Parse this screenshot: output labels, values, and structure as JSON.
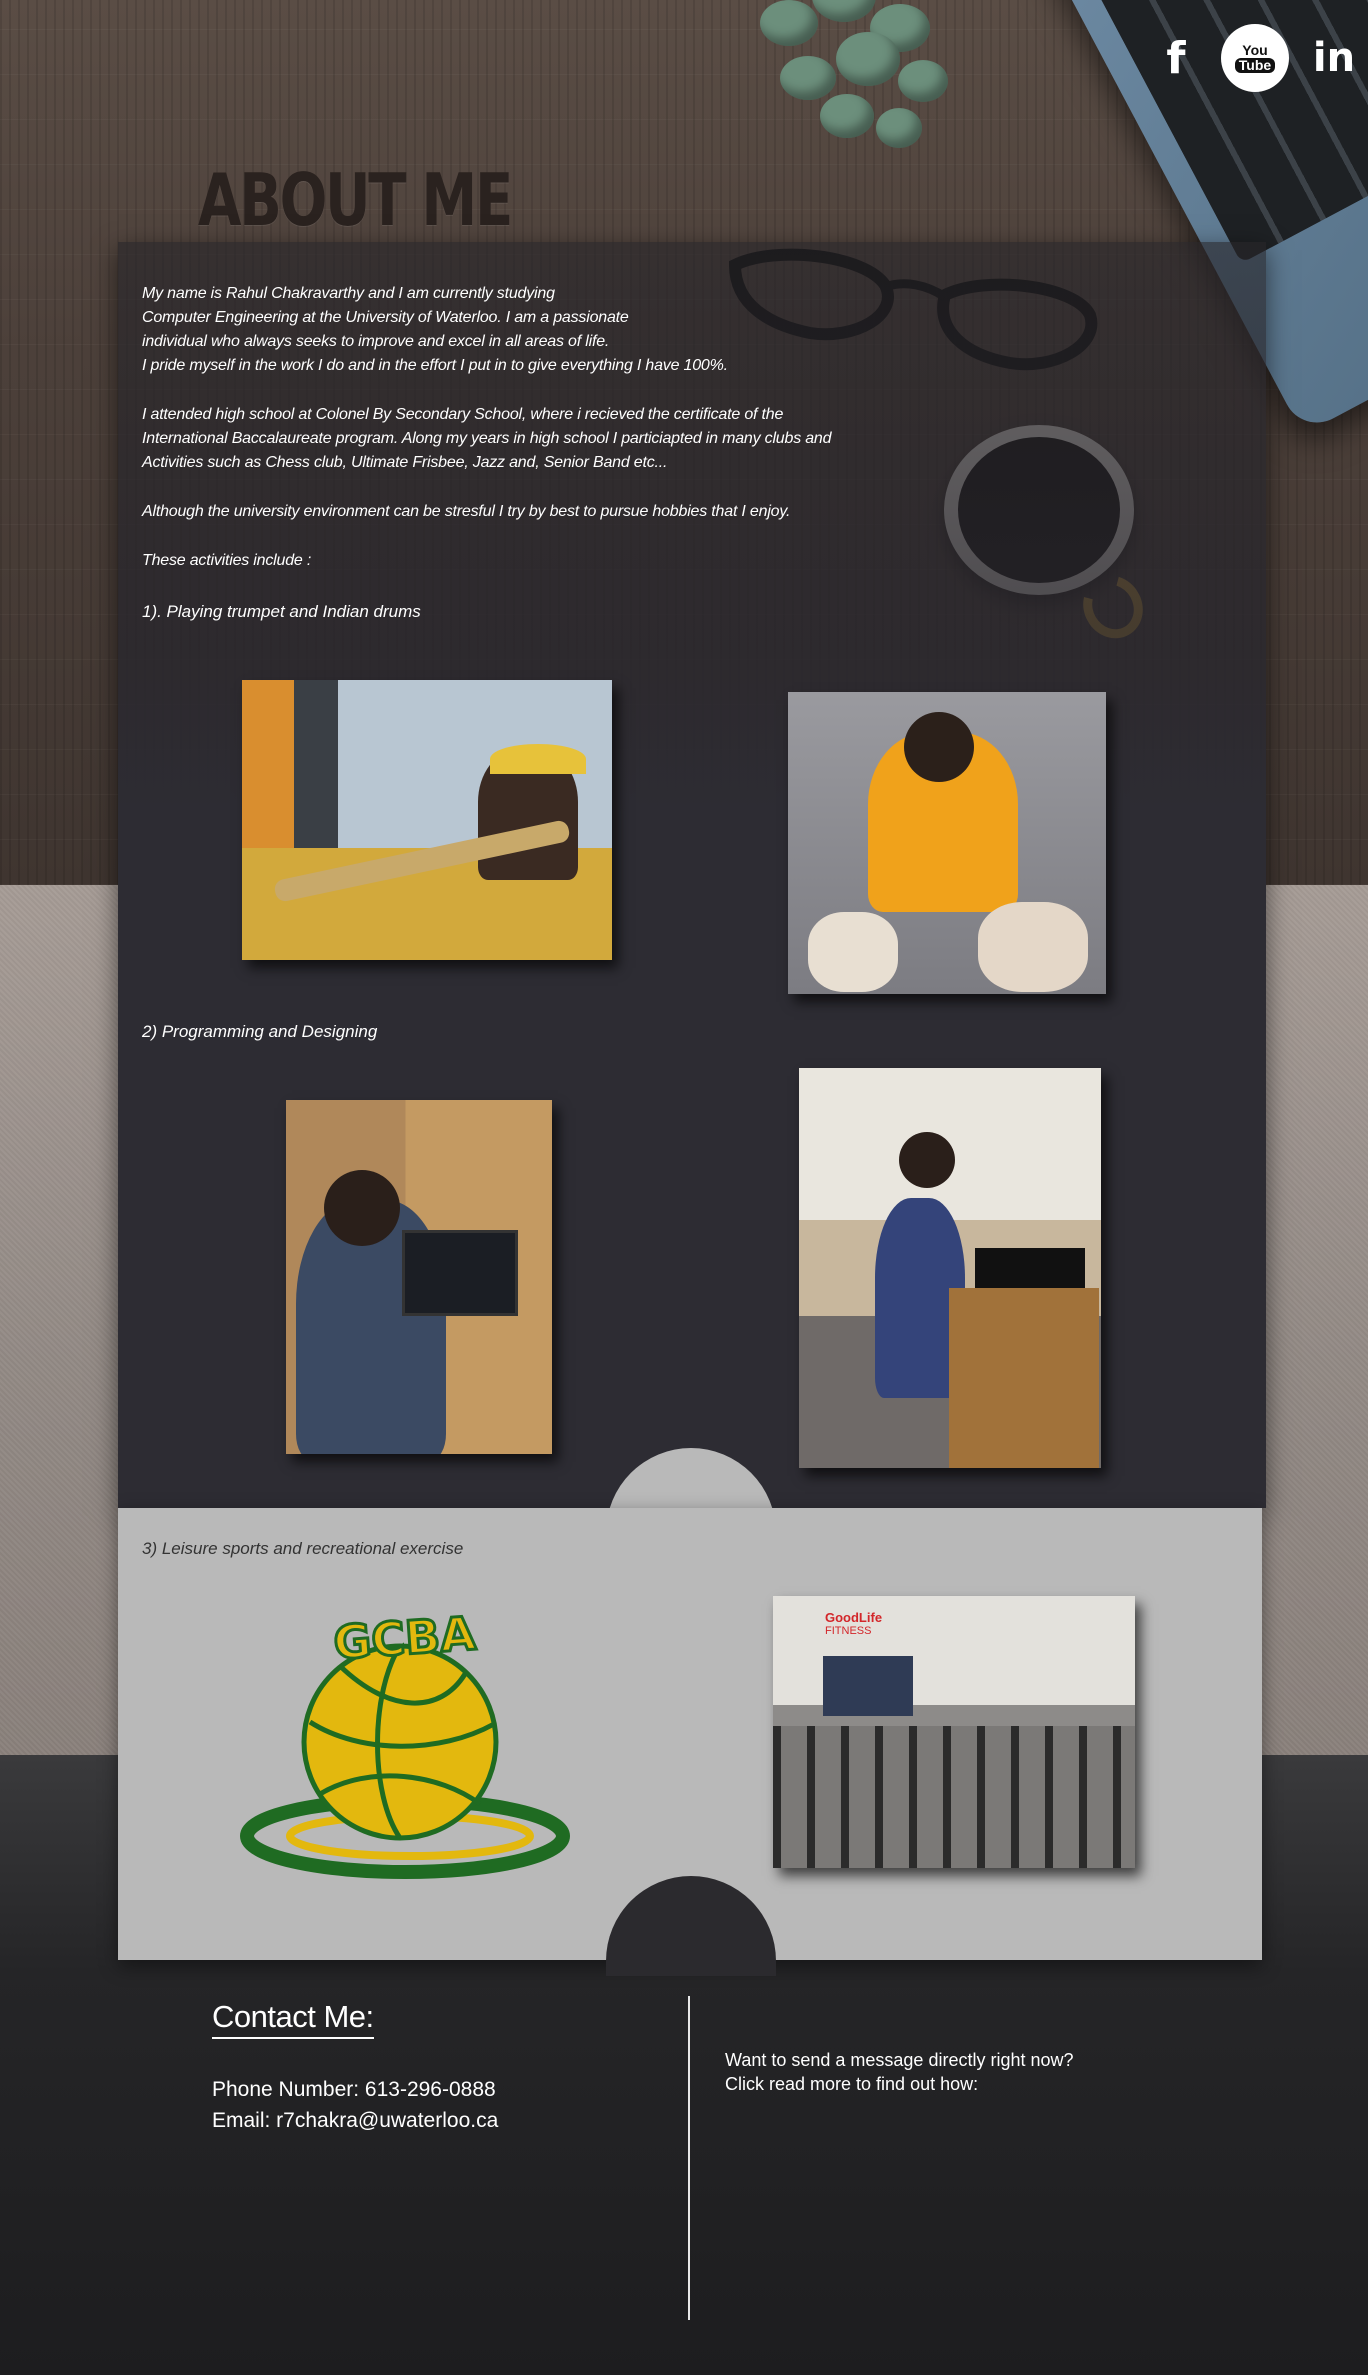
{
  "social": {
    "facebook_icon": "facebook-icon",
    "youtube_icon": "youtube-icon",
    "youtube_top": "You",
    "youtube_bottom": "Tube",
    "linkedin_icon": "linkedin-icon",
    "fb_glyph": "f",
    "li_glyph": "in"
  },
  "about": {
    "title": "ABOUT ME",
    "intro_lines": [
      "My name is Rahul  Chakravarthy and I am currently studying",
      "Computer Engineering at the University of Waterloo.  I am a passionate",
      "individual who always seeks to improve and excel  in all areas of life.",
      "I pride myself in the work I do and in the effort I put in to give everything I have 100%."
    ],
    "school_lines": [
      "I attended high school at Colonel By Secondary School, where i recieved the certificate of the",
      "International Baccalaureate program.  Along my years in high school I particiapted in many clubs and",
      "Activities such as Chess club, Ultimate Frisbee, Jazz and, Senior Band etc..."
    ],
    "hobbies_line": "Although the university environment can be stresful I try by best to pursue hobbies that I enjoy.",
    "activities_intro": "These activities include :",
    "activity_1": "1). Playing trumpet and Indian drums",
    "activity_2": "2) Programming and Designing",
    "activity_3": "3) Leisure sports and recreational exercise"
  },
  "photos": {
    "gym_sign_line1": "GoodLife",
    "gym_sign_line2": "FITNESS"
  },
  "logo": {
    "text": "GCBA",
    "colors": {
      "green": "#1f6b22",
      "yellow": "#e3b80e"
    }
  },
  "contact": {
    "title": "Contact Me:",
    "phone": "Phone Number: 613-296-0888",
    "email": "Email: r7chakra@uwaterloo.ca",
    "message_line1": "Want to send a message directly right now?",
    "message_line2": "Click read more to find out how:"
  },
  "colors": {
    "panel_dark": "#2d2c33",
    "panel_light": "#b9b9b9",
    "wood": "#4c403a",
    "stone": "#938a85"
  }
}
